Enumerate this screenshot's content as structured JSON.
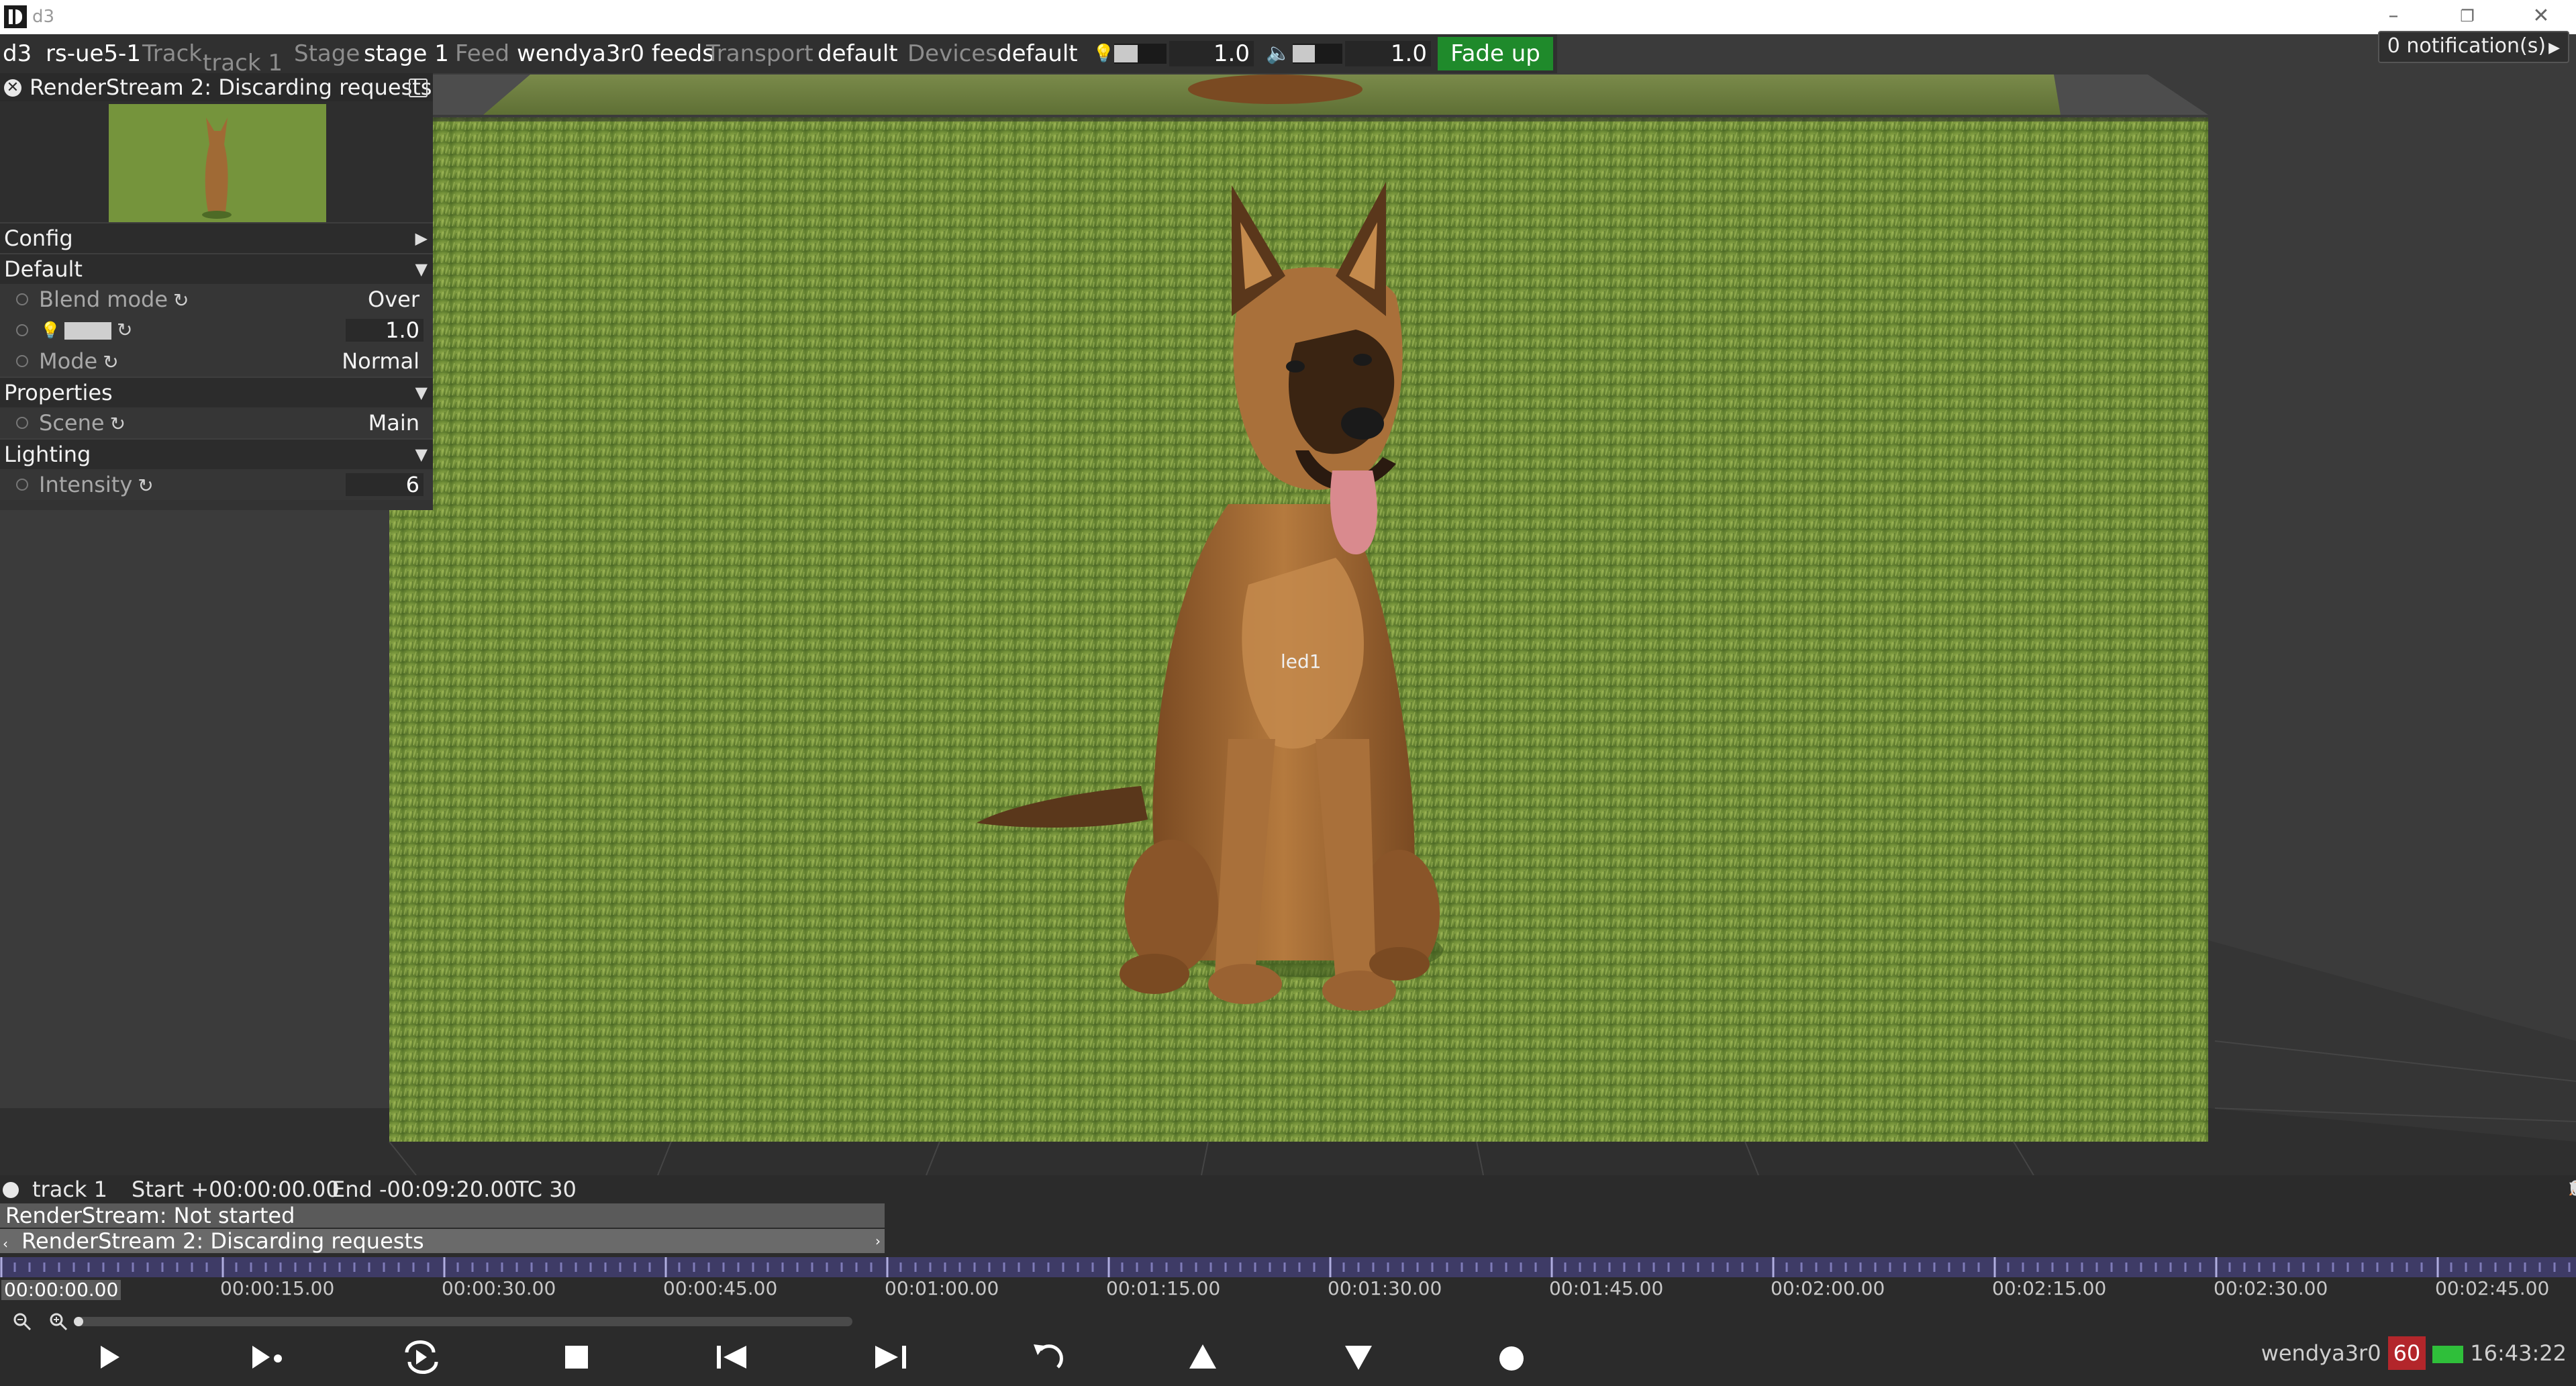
{
  "window": {
    "title": "d3",
    "minimize": "–",
    "maximize": "❐",
    "close": "✕"
  },
  "menubar": {
    "app": "d3",
    "project": "rs-ue5-1",
    "track_label": "Track",
    "track_value": "track 1",
    "track_tab": "track 1",
    "stage_label": "Stage",
    "stage_value": "stage 1",
    "feed_label": "Feed",
    "feed_value": "wendya3r0 feeds",
    "transport_label": "Transport",
    "transport_value": "default",
    "devices_label": "Devices",
    "devices_value": "default",
    "brightness_value": "1.0",
    "brightness_level": 0.45,
    "volume_value": "1.0",
    "volume_level": 0.45,
    "fade_button": "Fade up"
  },
  "notifications": "0 notification(s)",
  "panel": {
    "title": "RenderStream 2: Discarding requests",
    "sections": {
      "config": "Config",
      "default": "Default",
      "properties": "Properties",
      "lighting": "Lighting"
    },
    "blend_mode_label": "Blend mode",
    "blend_mode_value": "Over",
    "brightness_value": "1.0",
    "mode_label": "Mode",
    "mode_value": "Normal",
    "scene_label": "Scene",
    "scene_value": "Main",
    "intensity_label": "Intensity",
    "intensity_value": "6"
  },
  "viewport": {
    "led_label": "led1"
  },
  "timeline": {
    "track_name": "track 1",
    "start": "Start +00:00:00.00",
    "end": "End -00:09:20.00",
    "tc": "TC 30",
    "lane1": "RenderStream: Not started",
    "lane2": "RenderStream 2: Discarding requests",
    "current_time": "00:00:00.00",
    "ruler_labels": [
      "00:00:15.00",
      "00:00:30.00",
      "00:00:45.00",
      "00:01:00.00",
      "00:01:15.00",
      "00:01:30.00",
      "00:01:45.00",
      "00:02:00.00",
      "00:02:15.00",
      "00:02:30.00",
      "00:02:45.00"
    ],
    "right_count": "0"
  },
  "status": {
    "user": "wendya3r0",
    "fps": "60",
    "time": "16:43:22"
  },
  "colors": {
    "accent_green": "#1f8a2b",
    "fps_red": "#b3262b",
    "ruler_purple": "#3e3b66"
  }
}
